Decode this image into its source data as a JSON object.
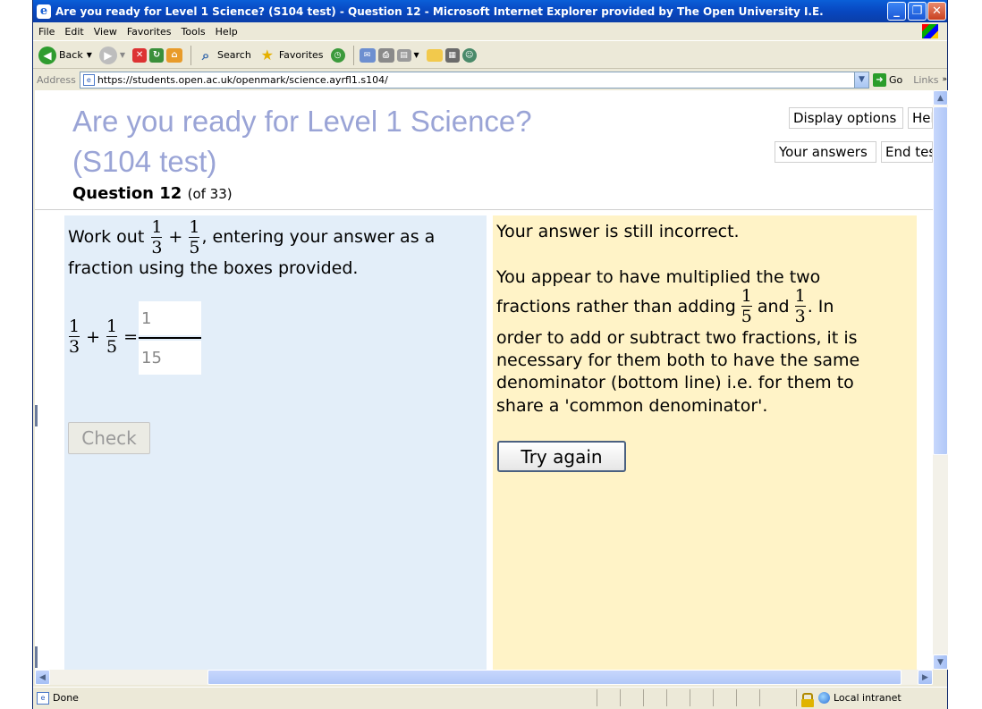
{
  "window": {
    "title": "Are you ready for Level 1 Science? (S104 test) - Question 12 - Microsoft Internet Explorer provided by The Open University I.E."
  },
  "menu": [
    "File",
    "Edit",
    "View",
    "Favorites",
    "Tools",
    "Help"
  ],
  "toolbar": {
    "back": "Back",
    "search": "Search",
    "favorites": "Favorites"
  },
  "address": {
    "label": "Address",
    "url": "https://students.open.ac.uk/openmark/science.ayrfl1.s104/",
    "go": "Go",
    "links": "Links"
  },
  "page": {
    "title_line1": "Are you ready for Level 1 Science?",
    "title_line2": "(S104 test)",
    "question_label": "Question 12",
    "question_of": "(of 33)",
    "buttons": {
      "display_options": "Display options",
      "help": "Help",
      "your_answers": "Your answers",
      "end_test": "End test"
    },
    "question": {
      "prefix": "Work out",
      "frac1_num": "1",
      "frac1_den": "3",
      "plus": "+",
      "frac2_num": "1",
      "frac2_den": "5",
      "suffix": ", entering your answer as a",
      "line2": "fraction using the boxes provided.",
      "equals": "=",
      "answer_num": "1",
      "answer_den": "15",
      "check": "Check"
    },
    "feedback": {
      "line1": "Your answer is still incorrect.",
      "p2_l1": "You appear to have multiplied the two",
      "p2_l2a": "fractions rather than adding",
      "f_a_num": "1",
      "f_a_den": "5",
      "and": "and",
      "f_b_num": "1",
      "f_b_den": "3",
      "p2_l2b": ". In",
      "p2_l3": "order to add or subtract two fractions, it is",
      "p2_l4": "necessary for them both to have the same",
      "p2_l5": "denominator (bottom line) i.e. for them to",
      "p2_l6": "share a 'common denominator'.",
      "try_again": "Try again"
    }
  },
  "status": {
    "text": "Done",
    "zone": "Local intranet"
  },
  "colors": {
    "question_panel": "#e3eef9",
    "feedback_panel": "#fff3c7",
    "title_text": "#9aa4d6"
  }
}
